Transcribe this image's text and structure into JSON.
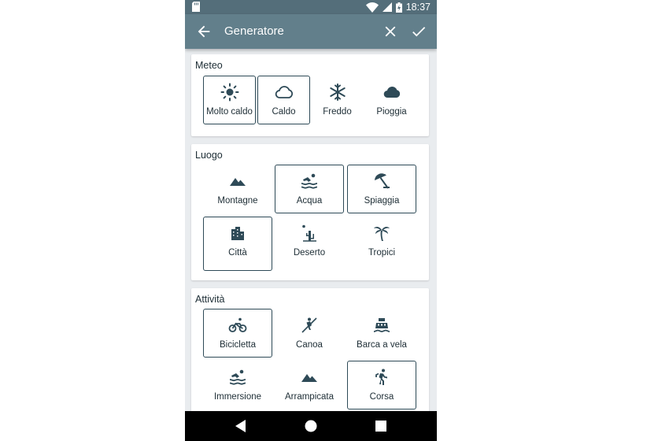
{
  "status": {
    "time": "18:37"
  },
  "appbar": {
    "title": "Generatore"
  },
  "sections": {
    "meteo": {
      "title": "Meteo",
      "items": [
        {
          "label": "Molto caldo",
          "icon": "sun-icon",
          "selected": true
        },
        {
          "label": "Caldo",
          "icon": "cloud-outline-icon",
          "selected": true
        },
        {
          "label": "Freddo",
          "icon": "snowflake-icon",
          "selected": false
        },
        {
          "label": "Pioggia",
          "icon": "cloud-filled-icon",
          "selected": false
        }
      ]
    },
    "luogo": {
      "title": "Luogo",
      "items": [
        {
          "label": "Montagne",
          "icon": "mountain-icon",
          "selected": false
        },
        {
          "label": "Acqua",
          "icon": "swimmer-icon",
          "selected": true
        },
        {
          "label": "Spiaggia",
          "icon": "beach-umbrella-icon",
          "selected": true
        },
        {
          "label": "Città",
          "icon": "city-icon",
          "selected": true
        },
        {
          "label": "Deserto",
          "icon": "cactus-icon",
          "selected": false
        },
        {
          "label": "Tropici",
          "icon": "palm-tree-icon",
          "selected": false
        }
      ]
    },
    "attivita": {
      "title": "Attività",
      "items": [
        {
          "label": "Bicicletta",
          "icon": "bicycle-icon",
          "selected": true
        },
        {
          "label": "Canoa",
          "icon": "rowing-icon",
          "selected": false
        },
        {
          "label": "Barca a vela",
          "icon": "boat-icon",
          "selected": false
        },
        {
          "label": "Immersione",
          "icon": "swimmer-icon",
          "selected": false
        },
        {
          "label": "Arrampicata",
          "icon": "mountain-icon",
          "selected": false
        },
        {
          "label": "Corsa",
          "icon": "running-icon",
          "selected": true
        }
      ]
    }
  },
  "colors": {
    "appbar": "#627f8b",
    "statusbar": "#546e7a",
    "icon": "#2e4a57",
    "selected_border": "#2e4a57"
  }
}
